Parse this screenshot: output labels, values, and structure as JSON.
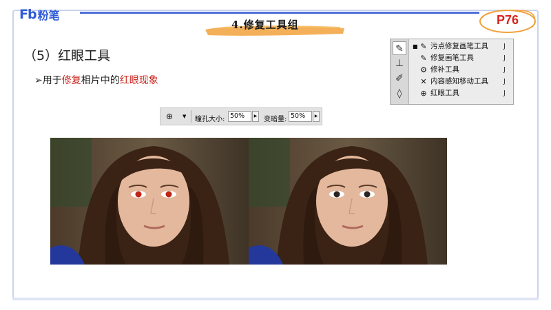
{
  "brand": {
    "mark": "Fb",
    "name": "粉笔"
  },
  "section_title": "4.修复工具组",
  "page_badge": "P76",
  "heading": "（5）红眼工具",
  "bullet": {
    "arrow": "➢",
    "part1": "用于",
    "part2_red": "修复",
    "part3": "相片中的",
    "part4_red": "红眼现象"
  },
  "tool_menu": {
    "items": [
      {
        "label": "污点修复画笔工具",
        "shortcut": "J",
        "icon": "spot-healing-brush-icon",
        "selected": true
      },
      {
        "label": "修复画笔工具",
        "shortcut": "J",
        "icon": "healing-brush-icon",
        "selected": false
      },
      {
        "label": "修补工具",
        "shortcut": "J",
        "icon": "patch-icon",
        "selected": false
      },
      {
        "label": "内容感知移动工具",
        "shortcut": "J",
        "icon": "content-aware-move-icon",
        "selected": false
      },
      {
        "label": "红眼工具",
        "shortcut": "J",
        "icon": "red-eye-icon",
        "selected": false
      }
    ]
  },
  "options_bar": {
    "pupil_label": "瞳孔大小:",
    "pupil_value": "50%",
    "darken_label": "变暗量:",
    "darken_value": "50%"
  },
  "colors": {
    "accent_blue": "#2f5bd8",
    "highlight_red": "#c8201a",
    "brush_orange": "#f2a23c"
  }
}
